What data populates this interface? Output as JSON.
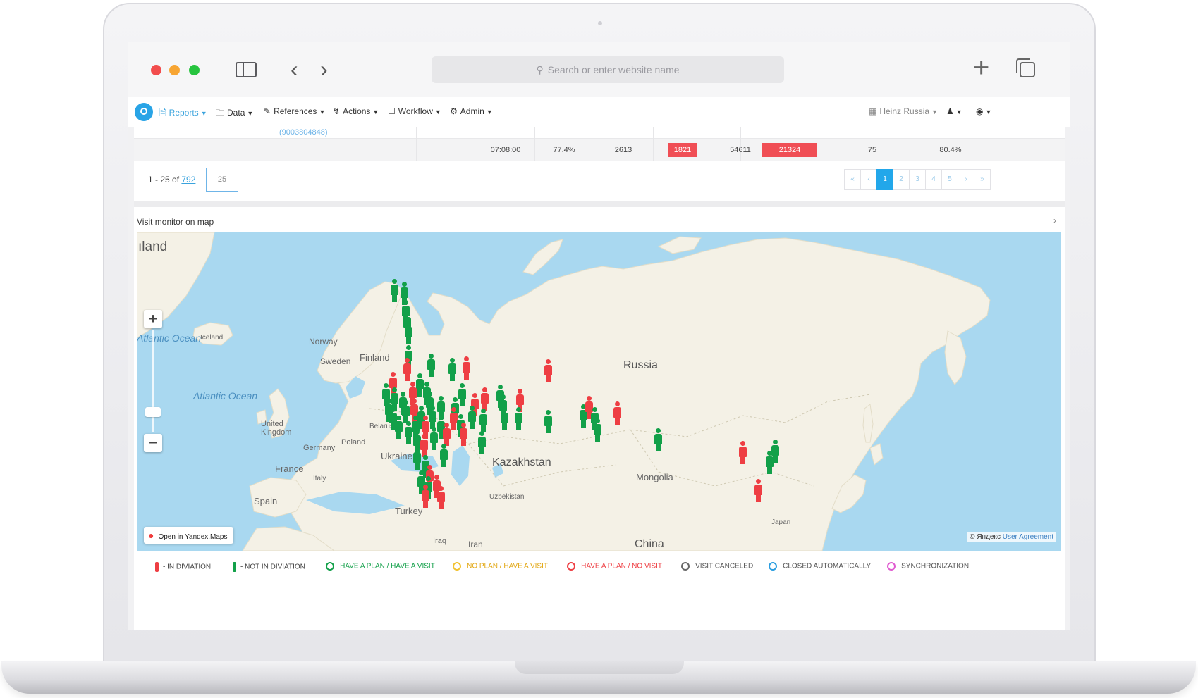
{
  "browser": {
    "url_placeholder": "Search or enter website name"
  },
  "nav": {
    "items": [
      {
        "label": "Reports",
        "icon": "document-icon"
      },
      {
        "label": "Data",
        "icon": "folder-icon"
      },
      {
        "label": "References",
        "icon": "pencil-icon"
      },
      {
        "label": "Actions",
        "icon": "bolt-icon"
      },
      {
        "label": "Workflow",
        "icon": "clipboard-icon"
      },
      {
        "label": "Admin",
        "icon": "gear-icon"
      }
    ],
    "account": "Heinz Russia"
  },
  "table": {
    "phone": "(9003804848)",
    "row": {
      "time": "07:08:00",
      "pct1": "77.4%",
      "val1": "2613",
      "val2": "1821",
      "val3": "54611",
      "val4": "21324",
      "val5": "75",
      "pct2": "80.4%"
    }
  },
  "pagination": {
    "range_prefix": "1 - 25 of ",
    "total": "792",
    "page_size": "25",
    "first": "«",
    "prev": "‹",
    "pages": [
      "1",
      "2",
      "3",
      "4",
      "5"
    ],
    "next": "›",
    "last": "»",
    "current_page": 1
  },
  "panel": {
    "title": "Visit monitor on map"
  },
  "map": {
    "labels": {
      "iland": "ıland",
      "atlantic1": "Atlantic Ocean",
      "atlantic2": "Atlantic Ocean",
      "iceland": "Iceland",
      "norway": "Norway",
      "sweden": "Sweden",
      "finland": "Finland",
      "uk": "United Kingdom",
      "belarus": "Belarus",
      "poland": "Poland",
      "germany": "Germany",
      "ukraine": "Ukraine",
      "france": "France",
      "italy": "Italy",
      "spain": "Spain",
      "turkey": "Turkey",
      "iraq": "Iraq",
      "iran": "Iran",
      "uzbekistan": "Uzbekistan",
      "kazakhstan": "Kazakhstan",
      "russia": "Russia",
      "mongolia": "Mongolia",
      "china": "China",
      "japan": "Japan"
    },
    "open_button": "Open in Yandex.Maps",
    "copyright": "© Яндекс ",
    "copyright_link": "User Agreement"
  },
  "legend": [
    {
      "label": "- IN DIVIATION",
      "color": "#ee3e43",
      "kind": "figure"
    },
    {
      "label": "- NOT IN DIVIATION",
      "color": "#12a049",
      "kind": "figure"
    },
    {
      "label": "- HAVE A PLAN / HAVE A VISIT",
      "color": "#12a049",
      "kind": "circle"
    },
    {
      "label": "- NO PLAN / HAVE A VISIT",
      "color": "#f2c230",
      "kind": "circle"
    },
    {
      "label": "- HAVE A PLAN / NO VISIT",
      "color": "#ee3e43",
      "kind": "circle"
    },
    {
      "label": "- VISIT CANCELED",
      "color": "#666666",
      "kind": "circle"
    },
    {
      "label": "- CLOSED AUTOMATICALLY",
      "color": "#2a9de0",
      "kind": "circle"
    },
    {
      "label": "- SYNCHRONIZATION",
      "color": "#e05ad0",
      "kind": "circle"
    }
  ],
  "colors": {
    "accent": "#22a7ea",
    "danger": "#f04e55",
    "in_deviation": "#ee3e43",
    "not_in_deviation": "#12a049"
  }
}
